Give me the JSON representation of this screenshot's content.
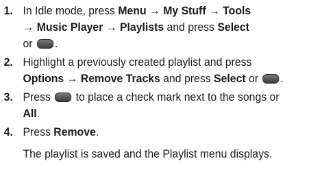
{
  "steps": [
    {
      "number": "1.",
      "parts": {
        "t1": "In Idle mode, press ",
        "b1": "Menu",
        "a1": " → ",
        "b2": "My Stuff",
        "a2": " → ",
        "b3": "Tools",
        "a3": "→ ",
        "b4": "Music Player",
        "a4": " → ",
        "b5": "Playlists",
        "t2": " and press ",
        "b6": "Select",
        "t3": "or ",
        "t4": "."
      }
    },
    {
      "number": "2.",
      "parts": {
        "t1": "Highlight a previously created playlist and press ",
        "b1": "Options",
        "a1": " → ",
        "b2": "Remove Tracks",
        "t2": " and press ",
        "b3": "Select",
        "t3": " or ",
        "t4": "."
      }
    },
    {
      "number": "3.",
      "parts": {
        "t1": "Press ",
        "t2": " to place a check mark next to the songs or ",
        "b1": "All",
        "t3": "."
      }
    },
    {
      "number": "4.",
      "parts": {
        "t1": "Press ",
        "b1": "Remove",
        "t2": "."
      }
    }
  ],
  "result_text": "The playlist is saved and the Playlist menu displays.",
  "icons": {
    "soft_key": "center-select-key-icon"
  }
}
